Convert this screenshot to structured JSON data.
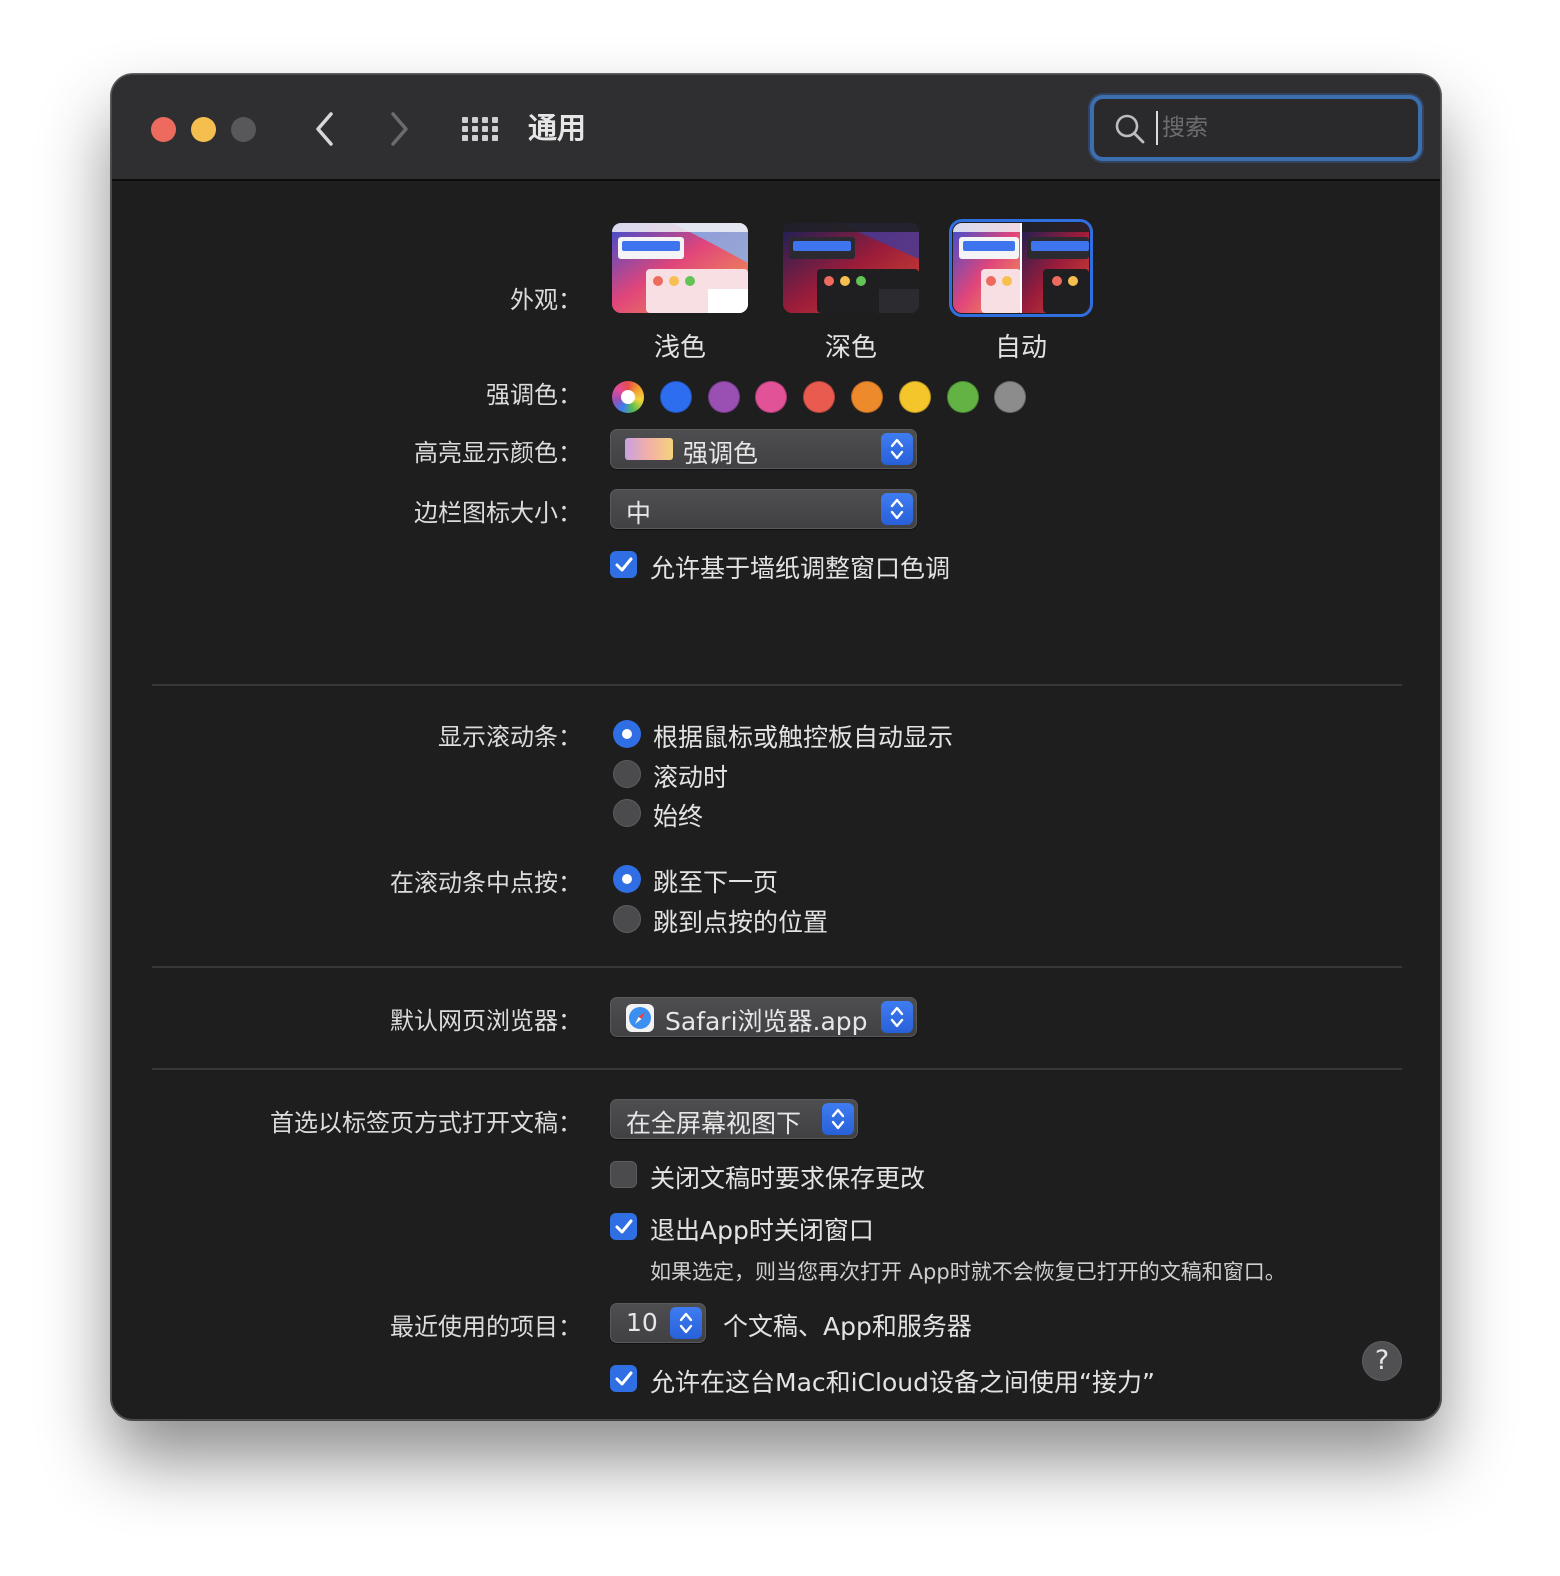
{
  "window": {
    "title": "通用",
    "search_placeholder": "搜索"
  },
  "appearance": {
    "label": "外观：",
    "options": [
      {
        "label": "浅色",
        "selected": false
      },
      {
        "label": "深色",
        "selected": false
      },
      {
        "label": "自动",
        "selected": true
      }
    ]
  },
  "accent_color": {
    "label": "强调色：",
    "colors": [
      "multicolor",
      "#2d6df0",
      "#9a4fb3",
      "#e25297",
      "#ea5b4f",
      "#ed8a2c",
      "#f4c62c",
      "#63b344",
      "#8c8c8c"
    ],
    "selected_index": 0
  },
  "highlight_color": {
    "label": "高亮显示颜色：",
    "value": "强调色"
  },
  "sidebar_icon_size": {
    "label": "边栏图标大小：",
    "value": "中"
  },
  "wallpaper_tinting": {
    "label": "允许基于墙纸调整窗口色调",
    "checked": true
  },
  "show_scroll_bars": {
    "label": "显示滚动条：",
    "options": [
      {
        "label": "根据鼠标或触控板自动显示",
        "selected": true
      },
      {
        "label": "滚动时",
        "selected": false
      },
      {
        "label": "始终",
        "selected": false
      }
    ]
  },
  "click_scroll_bar": {
    "label": "在滚动条中点按：",
    "options": [
      {
        "label": "跳至下一页",
        "selected": true
      },
      {
        "label": "跳到点按的位置",
        "selected": false
      }
    ]
  },
  "default_browser": {
    "label": "默认网页浏览器：",
    "value": "Safari浏览器.app"
  },
  "prefer_tabs": {
    "label": "首选以标签页方式打开文稿：",
    "value": "在全屏幕视图下"
  },
  "ask_keep_changes": {
    "label": "关闭文稿时要求保存更改",
    "checked": false
  },
  "close_windows": {
    "label": "退出App时关闭窗口",
    "checked": true,
    "note": "如果选定，则当您再次打开 App时就不会恢复已打开的文稿和窗口。"
  },
  "recent_items": {
    "label": "最近使用的项目：",
    "value": "10",
    "suffix": "个文稿、App和服务器"
  },
  "handoff": {
    "label": "允许在这台Mac和iCloud设备之间使用“接力”",
    "checked": true
  },
  "help": {
    "label": "?"
  }
}
